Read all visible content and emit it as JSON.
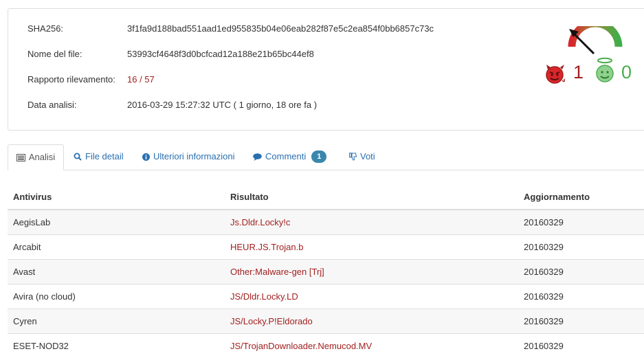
{
  "summary": {
    "sha256_label": "SHA256:",
    "sha256_value": "3f1fa9d188bad551aad1ed955835b04e06eab282f87e5c2ea854f0bb6857c73c",
    "filename_label": "Nome del file:",
    "filename_value": "53993cf4648f3d0bcfcad12a188e21b65bc44ef8",
    "ratio_label": "Rapporto rilevamento:",
    "ratio_value": "16 / 57",
    "date_label": "Data analisi:",
    "date_value": "2016-03-29 15:27:32 UTC ( 1 giorno, 18 ore fa )"
  },
  "votes": {
    "malicious_count": "1",
    "harmless_count": "0",
    "malicious_icon": "devil-face-icon",
    "harmless_icon": "angel-face-icon",
    "gauge_icon": "gauge-meter-icon"
  },
  "colors": {
    "malicious": "#a21f1f",
    "harmless": "#4cae4c",
    "link": "#2a6fb0",
    "badge": "#3a87ad"
  },
  "tabs": [
    {
      "label": "Analisi",
      "icon": "list-icon",
      "active": true
    },
    {
      "label": "File detail",
      "icon": "magnifier-icon"
    },
    {
      "label": "Ulteriori informazioni",
      "icon": "info-circle-icon"
    },
    {
      "label": "Commenti",
      "icon": "comment-icon",
      "badge": "1"
    },
    {
      "label": "Voti",
      "icon": "thumbs-down-icon"
    }
  ],
  "table": {
    "headers": [
      "Antivirus",
      "Risultato",
      "Aggiornamento"
    ],
    "rows": [
      {
        "antivirus": "AegisLab",
        "result": "Js.Dldr.Locky!c",
        "update": "20160329"
      },
      {
        "antivirus": "Arcabit",
        "result": "HEUR.JS.Trojan.b",
        "update": "20160329"
      },
      {
        "antivirus": "Avast",
        "result": "Other:Malware-gen [Trj]",
        "update": "20160329"
      },
      {
        "antivirus": "Avira (no cloud)",
        "result": "JS/Dldr.Locky.LD",
        "update": "20160329"
      },
      {
        "antivirus": "Cyren",
        "result": "JS/Locky.P!Eldorado",
        "update": "20160329"
      },
      {
        "antivirus": "ESET-NOD32",
        "result": "JS/TrojanDownloader.Nemucod.MV",
        "update": "20160329"
      }
    ]
  }
}
